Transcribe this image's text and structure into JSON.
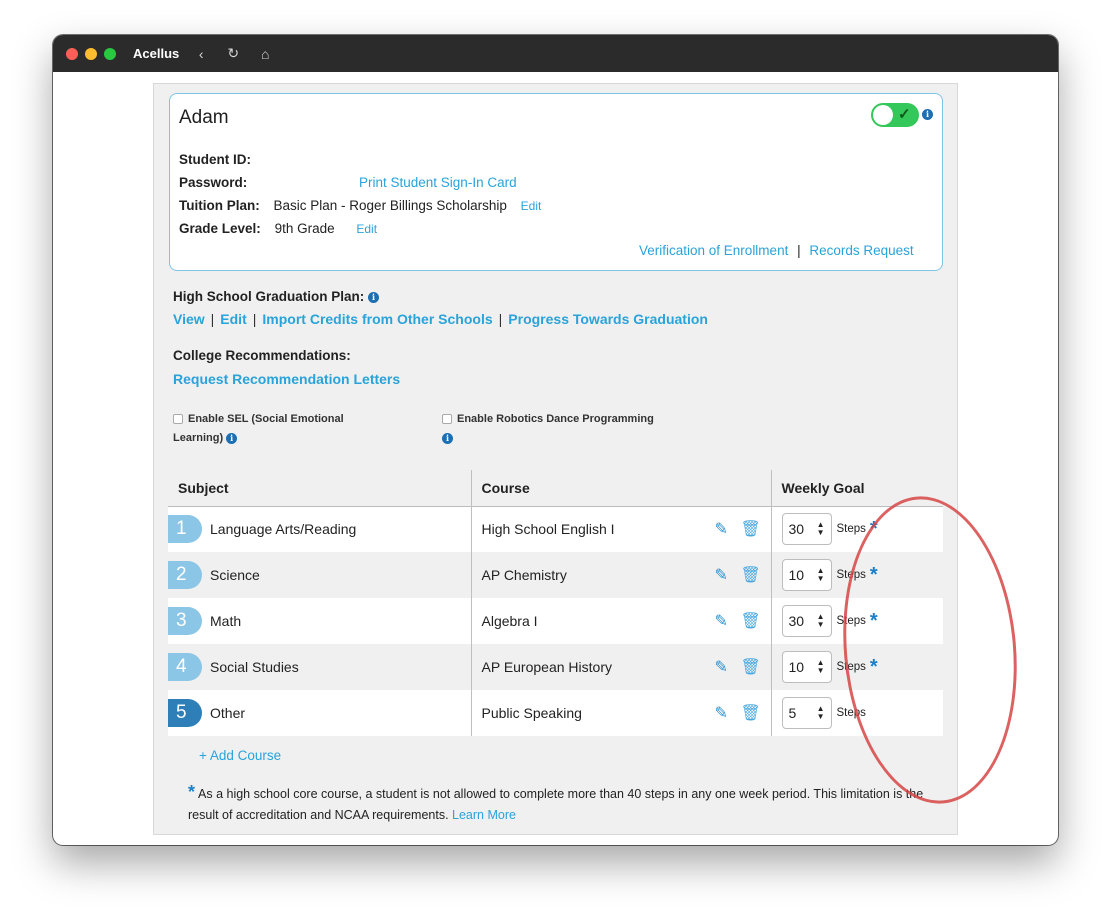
{
  "window": {
    "app_title": "Acellus"
  },
  "student": {
    "name": "Adam",
    "id_label": "Student ID:",
    "password_label": "Password:",
    "print_card_link": "Print Student Sign-In Card",
    "tuition_label": "Tuition Plan:",
    "tuition_value": "Basic Plan - Roger Billings Scholarship",
    "tuition_edit": "Edit",
    "grade_label": "Grade Level:",
    "grade_value": "9th Grade",
    "grade_edit": "Edit",
    "verification_link": "Verification of Enrollment",
    "records_link": "Records Request",
    "separator": "|",
    "enabled": true
  },
  "graduation": {
    "header": "High School Graduation Plan:",
    "links": [
      "View",
      "Edit",
      "Import Credits from Other Schools",
      "Progress Towards Graduation"
    ]
  },
  "college": {
    "header": "College Recommendations:",
    "link": "Request Recommendation Letters"
  },
  "options": {
    "sel_label_1": "Enable SEL (Social Emotional",
    "sel_label_2": "Learning)",
    "robotics_label": "Enable Robotics Dance Programming"
  },
  "table": {
    "headers": {
      "subject": "Subject",
      "course": "Course",
      "goal": "Weekly Goal"
    },
    "steps_label": "Steps",
    "rows": [
      {
        "num": "1",
        "subject": "Language Arts/Reading",
        "course": "High School English I",
        "goal": "30",
        "core": "*"
      },
      {
        "num": "2",
        "subject": "Science",
        "course": "AP Chemistry",
        "goal": "10",
        "core": "*"
      },
      {
        "num": "3",
        "subject": "Math",
        "course": "Algebra I",
        "goal": "30",
        "core": "*"
      },
      {
        "num": "4",
        "subject": "Social Studies",
        "course": "AP European History",
        "goal": "10",
        "core": "*"
      },
      {
        "num": "5",
        "subject": "Other",
        "course": "Public Speaking",
        "goal": "5",
        "core": ""
      }
    ]
  },
  "add_course": "+ Add Course",
  "footnote": {
    "asterisk": "*",
    "text": "As a high school core course, a student is not allowed to complete more than 40 steps in any one week period. This limitation is the result of accreditation and NCAA requirements.",
    "learn_more": "Learn More"
  },
  "colors": {
    "accent": "#29a3d9",
    "toggle_on": "#34c759",
    "highlight_circle": "#d64545"
  }
}
